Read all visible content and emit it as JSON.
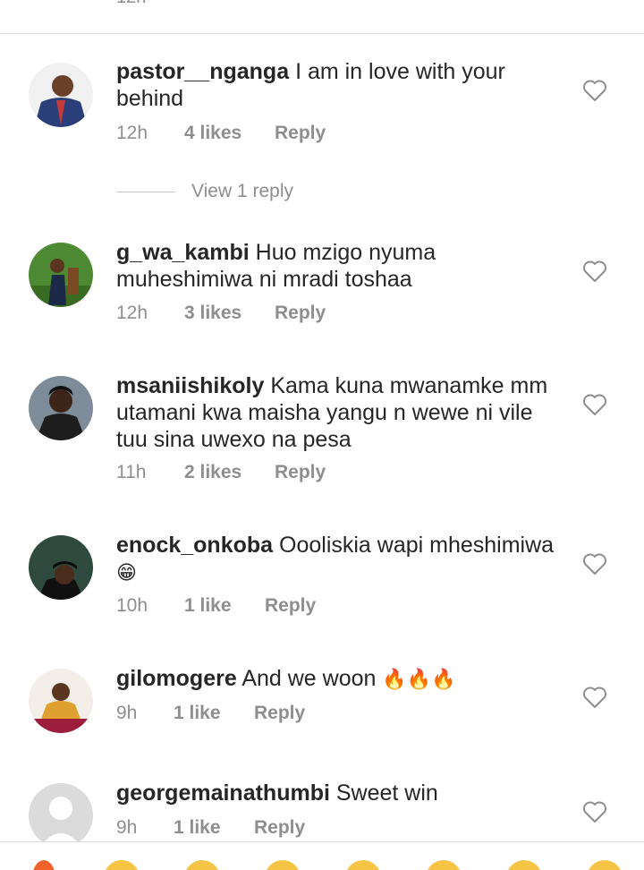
{
  "top_partial_time": "12h",
  "comments": [
    {
      "username": "pastor__nganga",
      "text": "I am in love with your behind",
      "time": "12h",
      "likes": "4 likes",
      "reply": "Reply",
      "view_replies": "View 1 reply"
    },
    {
      "username": "g_wa_kambi",
      "text": "Huo mzigo nyuma muheshimiwa ni mradi toshaa",
      "time": "12h",
      "likes": "3 likes",
      "reply": "Reply"
    },
    {
      "username": "msaniishikoly",
      "text": "Kama kuna mwanamke mm utamani kwa maisha yangu n wewe ni vile tuu sina uwexo na pesa",
      "time": "11h",
      "likes": "2 likes",
      "reply": "Reply"
    },
    {
      "username": "enock_onkoba",
      "text": "Oooliskia wapi mheshimiwa",
      "emoji": "😁",
      "time": "10h",
      "likes": "1 like",
      "reply": "Reply"
    },
    {
      "username": "gilomogere",
      "text": "And we woon",
      "emoji": "🔥🔥🔥",
      "time": "9h",
      "likes": "1 like",
      "reply": "Reply"
    },
    {
      "username": "georgemainathumbi",
      "text": "Sweet win",
      "time": "9h",
      "likes": "1 like",
      "reply": "Reply"
    }
  ],
  "icons": {
    "like": "heart-outline-icon",
    "default_avatar": "default-avatar-icon"
  },
  "colors": {
    "text": "#262626",
    "secondary": "#8e8e8e",
    "divider": "#dbdbdb"
  }
}
